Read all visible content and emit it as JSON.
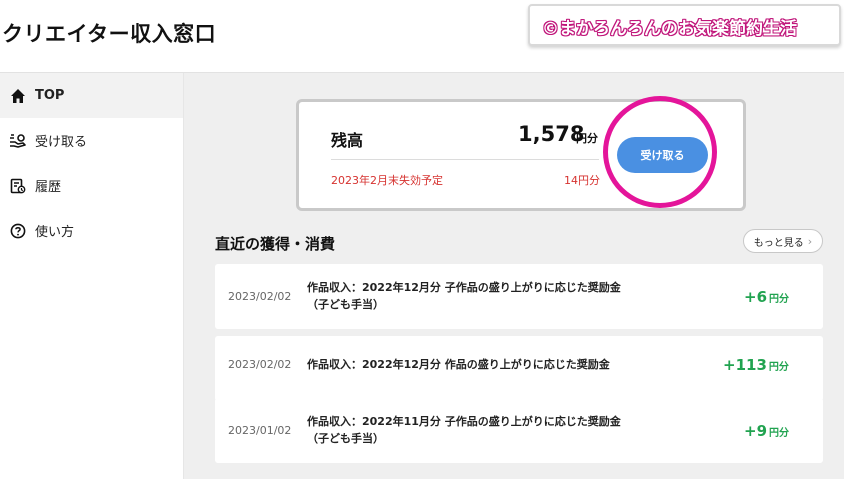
{
  "header": {
    "app_title": "クリエイター収入窓口",
    "watermark": "©まかろんろんのお気楽節約生活"
  },
  "sidebar": {
    "items": [
      {
        "label": "TOP",
        "icon": "home-icon",
        "active": true
      },
      {
        "label": "受け取る",
        "icon": "receive-icon",
        "active": false
      },
      {
        "label": "履歴",
        "icon": "history-icon",
        "active": false
      },
      {
        "label": "使い方",
        "icon": "help-icon",
        "active": false
      }
    ]
  },
  "balance": {
    "label": "残高",
    "value": "1,578",
    "unit": "円分",
    "expire_label": "2023年2月末失効予定",
    "expire_value": "14円分",
    "receive_button": "受け取る"
  },
  "recent": {
    "title": "直近の獲得・消費",
    "more_button": "もっと見る",
    "rows": [
      {
        "date": "2023/02/02",
        "desc_line1": "作品収入：2022年12月分 子作品の盛り上がりに応じた奨励金",
        "desc_line2": "（子ども手当）",
        "amount": "+6",
        "unit": "円分"
      },
      {
        "date": "2023/02/02",
        "desc_line1": "作品収入：2022年12月分 作品の盛り上がりに応じた奨励金",
        "desc_line2": "",
        "amount": "+113",
        "unit": "円分"
      },
      {
        "date": "2023/01/02",
        "desc_line1": "作品収入：2022年11月分 子作品の盛り上がりに応じた奨励金",
        "desc_line2": "（子ども手当）",
        "amount": "+9",
        "unit": "円分"
      }
    ]
  },
  "colors": {
    "accent_blue": "#4a90e2",
    "income_green": "#21a350",
    "expire_red": "#d6322f",
    "highlight_pink": "#e4159a"
  }
}
